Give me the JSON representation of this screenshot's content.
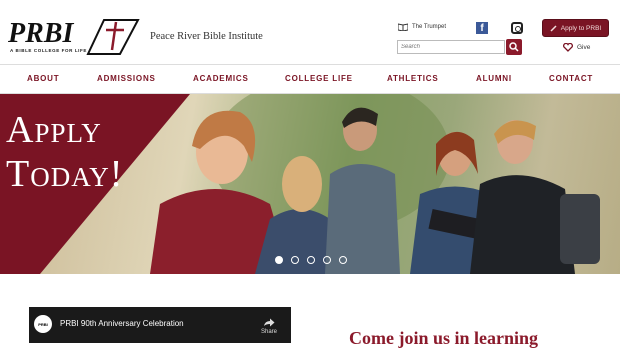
{
  "header": {
    "logo_text": "PRBI",
    "logo_tagline": "A BIBLE COLLEGE FOR LIFE",
    "site_name": "Peace River Bible Institute",
    "trumpet_label": "The Trumpet",
    "search_placeholder": "Search",
    "apply_label": "Apply to PRBI",
    "give_label": "Give",
    "facebook_icon": "facebook-icon",
    "instagram_icon": "instagram-icon",
    "accent_color": "#7a1424"
  },
  "nav": {
    "items": [
      {
        "label": "ABOUT"
      },
      {
        "label": "ADMISSIONS"
      },
      {
        "label": "ACADEMICS"
      },
      {
        "label": "COLLEGE LIFE"
      },
      {
        "label": "ATHLETICS"
      },
      {
        "label": "ALUMNI"
      },
      {
        "label": "CONTACT"
      }
    ]
  },
  "hero": {
    "line1": "Apply",
    "line2": "Today!",
    "slides_total": 5,
    "active_slide": 1
  },
  "video": {
    "logo_text": "PRBI",
    "title": "PRBI 90th Anniversary Celebration",
    "share_label": "Share"
  },
  "main": {
    "heading_partial": "Come join us in learning"
  }
}
